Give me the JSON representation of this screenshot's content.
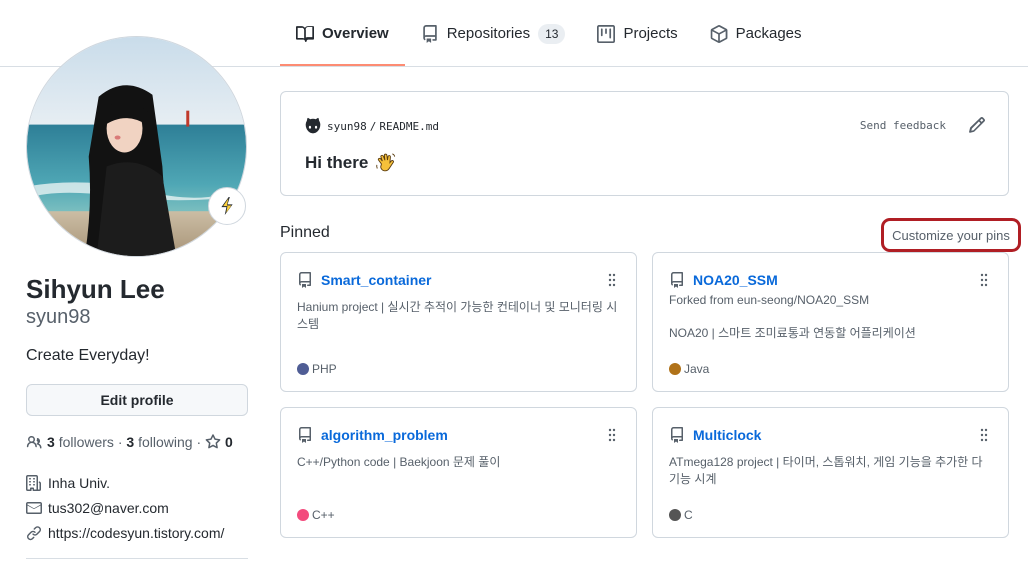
{
  "nav": {
    "tabs": [
      {
        "label": "Overview",
        "icon": "book-icon",
        "active": true
      },
      {
        "label": "Repositories",
        "icon": "repo-icon",
        "counter": "13"
      },
      {
        "label": "Projects",
        "icon": "project-icon"
      },
      {
        "label": "Packages",
        "icon": "package-icon"
      }
    ]
  },
  "profile": {
    "name": "Sihyun Lee",
    "login": "syun98",
    "bio": "Create Everyday!",
    "edit_label": "Edit profile",
    "followers_count": "3",
    "followers_label": "followers",
    "dot": "·",
    "following_count": "3",
    "following_label": "following",
    "stars_sep": "·",
    "stars_count": "0",
    "company": "Inha Univ.",
    "email": "tus302@naver.com",
    "website": "https://codesyun.tistory.com/"
  },
  "readme": {
    "owner": "syun98",
    "sep": "/",
    "file": "README.md",
    "feedback": "Send feedback",
    "greeting": "Hi there"
  },
  "pinned": {
    "title": "Pinned",
    "customize": "Customize your pins",
    "items": [
      {
        "name": "Smart_container",
        "forked": "",
        "desc": "Hanium project | 실시간 추적이 가능한 컨테이너 및 모니터링 시스템",
        "lang": "PHP",
        "color": "#4F5D95"
      },
      {
        "name": "NOA20_SSM",
        "forked": "Forked from eun-seong/NOA20_SSM",
        "desc": "NOA20 | 스마트 조미료통과 연동할 어플리케이션",
        "lang": "Java",
        "color": "#b07219"
      },
      {
        "name": "algorithm_problem",
        "forked": "",
        "desc": "C++/Python code | Baekjoon 문제 풀이",
        "lang": "C++",
        "color": "#f34b7d"
      },
      {
        "name": "Multiclock",
        "forked": "",
        "desc": "ATmega128 project | 타이머, 스톱워치, 게임 기능을 추가한 다기능 시계",
        "lang": "C",
        "color": "#555555"
      }
    ]
  },
  "colors": {
    "accent_underline": "#fd8c73",
    "link": "#0969da",
    "highlight_box": "#b01e24"
  }
}
